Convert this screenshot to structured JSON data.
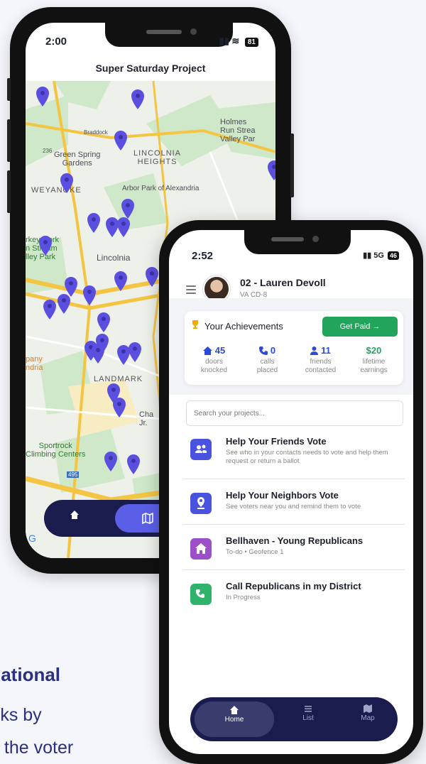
{
  "promo": {
    "headline": "lational",
    "line1": "rks by",
    "line2": "t the voter"
  },
  "phone_back": {
    "status_time": "2:00",
    "battery": "81",
    "title": "Super Saturday Project",
    "map_labels": {
      "holmes": "Holmes\nRun Strea\nValley Par",
      "green_spring": "Green Spring\nGardens",
      "road_236": "236",
      "braddock": "Braddock",
      "lincolnia_heights": "LINCOLNIA\nHEIGHTS",
      "weyanoke": "WEYANOKE",
      "arbor_park": "Arbor Park of Alexandria",
      "turkey_creek": "rkey Cork\nn Stream\nlley Park",
      "lincolnia": "Lincolnia",
      "company": "pany\nndria",
      "landmark": "LANDMARK",
      "cha": "Cha\nJr.",
      "sportrock": "Sportrock\nClimbing Centers",
      "road_495": "495",
      "g": "G"
    },
    "nav": {
      "home_icon": "home-icon",
      "map_icon": "map-icon"
    }
  },
  "phone_front": {
    "status_time": "2:52",
    "signal": "5G",
    "battery": "46",
    "user": {
      "name": "02 - Lauren Devoll",
      "district": "VA CD-8"
    },
    "achievements": {
      "title": "Your Achievements",
      "button": "Get Paid →",
      "stats": [
        {
          "icon": "house-icon",
          "value": "45",
          "label": "doors\nknocked"
        },
        {
          "icon": "phone-icon",
          "value": "0",
          "label": "calls\nplaced"
        },
        {
          "icon": "person-icon",
          "value": "11",
          "label": "friends\ncontacted"
        },
        {
          "icon": "dollar-icon",
          "value": "$20",
          "label": "lifetime\nearnings"
        }
      ]
    },
    "search_placeholder": "Search your projects...",
    "projects": [
      {
        "title": "Help Your Friends Vote",
        "desc": "See who in your contacts needs to vote and help them request or return a ballot",
        "color": "#4a52e0",
        "icon": "contacts-icon"
      },
      {
        "title": "Help Your Neighbors Vote",
        "desc": "See voters near you and remind them to vote",
        "color": "#4a52e0",
        "icon": "location-pin-icon"
      },
      {
        "title": "Bellhaven - Young Republicans",
        "desc": "To-do • Geofence 1",
        "color": "#9b4fc9",
        "icon": "house-icon"
      },
      {
        "title": "Call Republicans in my District",
        "desc": "In Progress",
        "color": "#2fb36c",
        "icon": "phone-icon"
      }
    ],
    "nav": [
      {
        "label": "Home",
        "icon": "home-icon"
      },
      {
        "label": "List",
        "icon": "list-icon"
      },
      {
        "label": "Map",
        "icon": "map-icon"
      }
    ]
  }
}
